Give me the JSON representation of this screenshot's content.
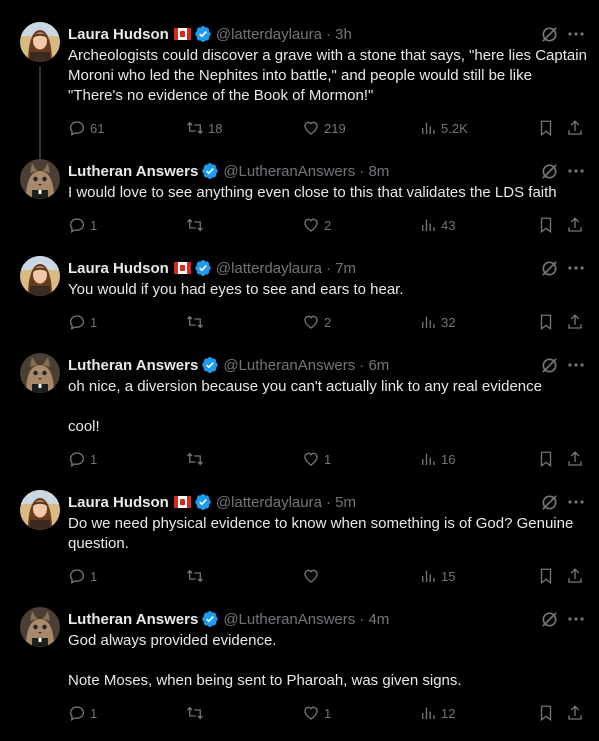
{
  "tweets": [
    {
      "author": "Laura Hudson",
      "show_flag": true,
      "handle": "@latterdaylaura",
      "time": "· 3h",
      "text": "Archeologists could discover a grave with a stone that says, \"here lies Captain Moroni who led the Nephites into battle,\" and people would still be like \"There's no evidence of the Book of Mormon!\"",
      "replies": "61",
      "reposts": "18",
      "likes": "219",
      "views": "5.2K"
    },
    {
      "author": "Lutheran Answers",
      "show_flag": false,
      "handle": "@LutheranAnswers",
      "time": "· 8m",
      "text": "I would love to see anything even close to this that validates the LDS faith",
      "replies": "1",
      "reposts": "",
      "likes": "2",
      "views": "43"
    },
    {
      "author": "Laura Hudson",
      "show_flag": true,
      "handle": "@latterdaylaura",
      "time": "· 7m",
      "text": "You would if you had eyes to see and ears to hear.",
      "replies": "1",
      "reposts": "",
      "likes": "2",
      "views": "32"
    },
    {
      "author": "Lutheran Answers",
      "show_flag": false,
      "handle": "@LutheranAnswers",
      "time": "· 6m",
      "text": "oh nice, a diversion because you can't actually link to any real evidence\n\ncool!",
      "replies": "1",
      "reposts": "",
      "likes": "1",
      "views": "16"
    },
    {
      "author": "Laura Hudson",
      "show_flag": true,
      "handle": "@latterdaylaura",
      "time": "· 5m",
      "text": "Do we need physical evidence to know when something is of God? Genuine question.",
      "replies": "1",
      "reposts": "",
      "likes": "",
      "views": "15"
    },
    {
      "author": "Lutheran Answers",
      "show_flag": false,
      "handle": "@LutheranAnswers",
      "time": "· 4m",
      "text": "God always provided evidence.\n\nNote Moses, when being sent to Pharoah, was given signs.",
      "replies": "1",
      "reposts": "",
      "likes": "1",
      "views": "12"
    }
  ],
  "colors": {
    "background": "#000000",
    "text": "#e7e9ea",
    "muted": "#71767b",
    "verified": "#1d9bf0",
    "divider": "#2f3336"
  },
  "icons": [
    "verified-badge-icon",
    "canada-flag-icon",
    "grok-icon",
    "more-icon",
    "reply-icon",
    "repost-icon",
    "like-icon",
    "views-icon",
    "bookmark-icon",
    "share-icon"
  ]
}
